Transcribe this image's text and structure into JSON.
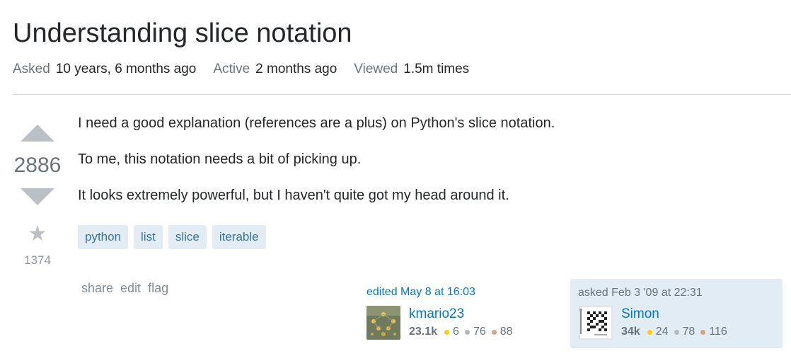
{
  "question": {
    "title": "Understanding slice notation",
    "meta": {
      "asked_label": "Asked",
      "asked_value": "10 years, 6 months ago",
      "active_label": "Active",
      "active_value": "2 months ago",
      "viewed_label": "Viewed",
      "viewed_value": "1.5m times"
    },
    "votes": "2886",
    "favorites": "1374",
    "body": [
      "I need a good explanation (references are a plus) on Python's slice notation.",
      "To me, this notation needs a bit of picking up.",
      "It looks extremely powerful, but I haven't quite got my head around it."
    ],
    "tags": [
      "python",
      "list",
      "slice",
      "iterable"
    ],
    "menu": [
      "share",
      "edit",
      "flag"
    ],
    "editor": {
      "action": "edited May 8 at 16:03",
      "name": "kmario23",
      "reputation": "23.1k",
      "gold": "6",
      "silver": "76",
      "bronze": "88"
    },
    "owner": {
      "action": "asked Feb 3 '09 at 22:31",
      "name": "Simon",
      "reputation": "34k",
      "gold": "24",
      "silver": "78",
      "bronze": "116"
    }
  },
  "colors": {
    "gold": "#ffcc01",
    "silver": "#b4b8bc",
    "bronze": "#d1a684",
    "link": "#0077cc",
    "tag_bg": "#e1ecf4",
    "tag_fg": "#39739d"
  },
  "icons": {
    "upvote": "upvote-arrow-icon",
    "downvote": "downvote-arrow-icon",
    "favorite": "star-icon"
  }
}
